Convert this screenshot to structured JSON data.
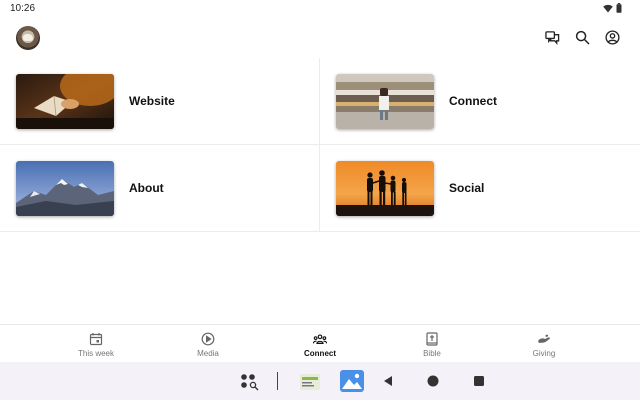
{
  "status": {
    "time": "10:26"
  },
  "tiles": [
    {
      "label": "Website",
      "image": "bible-reading-photo"
    },
    {
      "label": "Connect",
      "image": "train-platform-photo"
    },
    {
      "label": "About",
      "image": "mountain-photo"
    },
    {
      "label": "Social",
      "image": "sunset-silhouettes-photo"
    }
  ],
  "nav": [
    {
      "label": "This week",
      "icon": "calendar-icon"
    },
    {
      "label": "Media",
      "icon": "play-circle-icon"
    },
    {
      "label": "Connect",
      "icon": "group-icon",
      "active": true
    },
    {
      "label": "Bible",
      "icon": "bible-icon"
    },
    {
      "label": "Giving",
      "icon": "giving-hand-icon"
    }
  ],
  "colors": {
    "accent": "#111111",
    "inactive": "#777777",
    "system_bar": "#f4f1f8"
  }
}
